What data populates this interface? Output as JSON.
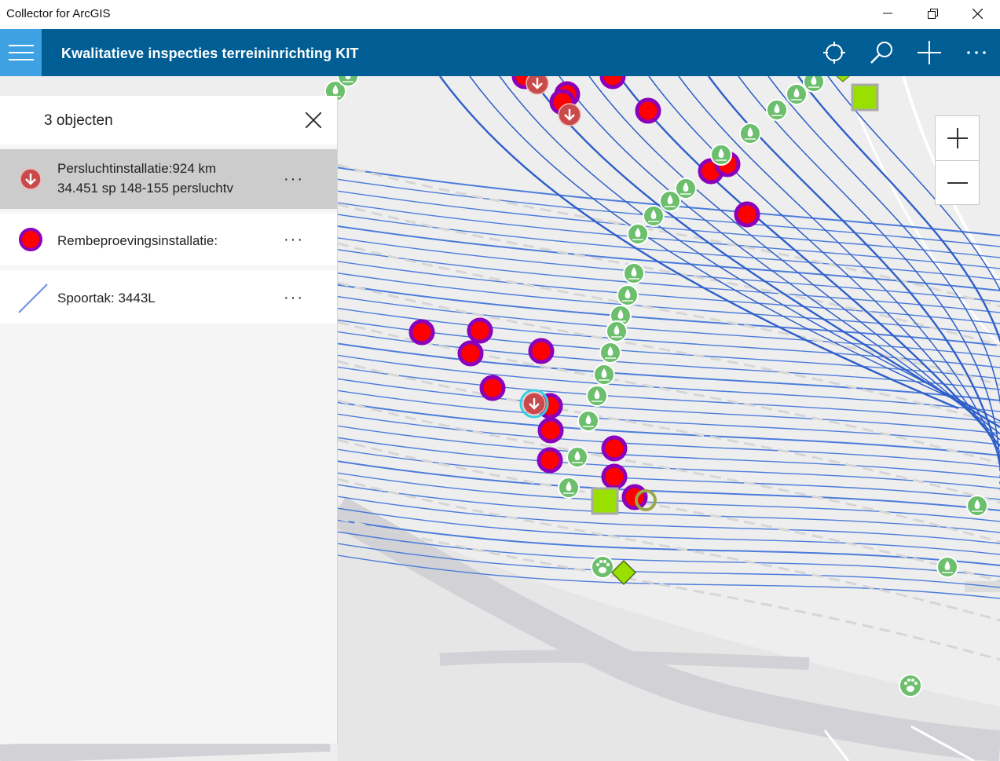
{
  "window": {
    "title": "Collector for ArcGIS",
    "controls": [
      "minimize",
      "restore",
      "close"
    ]
  },
  "appbar": {
    "title": "Kwalitatieve inspecties terreininrichting KIT",
    "menu_icon": "hamburger-icon",
    "tools": [
      "locate-icon",
      "search-icon",
      "add-icon",
      "more-icon"
    ],
    "color": "#005e95",
    "menu_color": "#3ea2e2"
  },
  "results_panel": {
    "count_label": "3 objecten",
    "items": [
      {
        "icon": "persluchtinstallatie-symbol",
        "line1": "Persluchtinstallatie:924 km",
        "line2": "34.451 sp 148-155 persluchtv",
        "more": "···",
        "selected": true
      },
      {
        "icon": "rembeproevingsinstallatie-symbol",
        "line1": "Rembeproevingsinstallatie:",
        "more": "···",
        "selected": false
      },
      {
        "icon": "spoortak-line-symbol",
        "line1": "Spoortak: 3443L",
        "more": "···",
        "selected": false
      }
    ]
  },
  "map": {
    "zoom_in": "+",
    "zoom_out": "−",
    "colors": {
      "track": "#3a6fd8",
      "red_marker": "#ff0000",
      "purple_ring": "#8b00b8",
      "green_symbol": "#6cbf6c",
      "lime_symbol": "#99e000"
    }
  }
}
